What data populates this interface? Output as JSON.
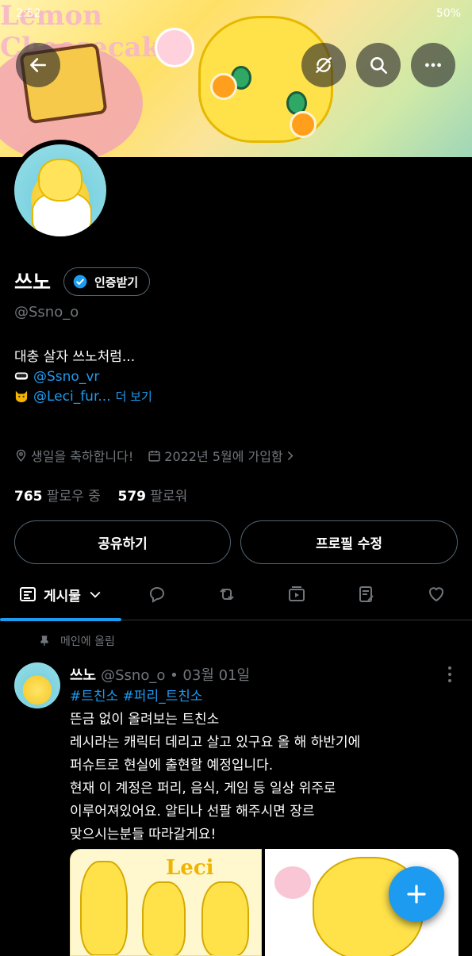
{
  "status_bar": {
    "time": "2:52",
    "indicators": "50% "
  },
  "banner": {
    "art_text": "Lemon Cheesecake"
  },
  "profile": {
    "display_name": "쓰노",
    "verify_label": "인증받기",
    "handle": "@Ssno_o",
    "bio_line1": "대충 살자 쓰노처럼...",
    "bio_link1": "@Ssno_vr",
    "bio_link2": "@Leci_fur...",
    "bio_more": "더 보기",
    "birthday": "생일을 축하합니다!",
    "joined": "2022년 5월에 가입함",
    "following_count": "765",
    "following_label": "팔로우 중",
    "followers_count": "579",
    "followers_label": "팔로워"
  },
  "actions": {
    "share": "공유하기",
    "edit_profile": "프로필 수정"
  },
  "tabs": {
    "posts": "게시물"
  },
  "pinned_label": "메인에 올림",
  "post": {
    "name": "쓰노",
    "handle_date": "@Ssno_o • 03월 01일",
    "tags": "#트친소 #퍼리_트친소",
    "lines": [
      "뜬금 없이 올려보는 트친소",
      "레시라는 캐릭터 데리고 살고 있구요 올 해 하반기에",
      "퍼슈트로 현실에 출현할 예정입니다.",
      "현재 이 계정은 퍼리, 음식, 게임 등 일상 위주로",
      "이루어져있어요. 알티나 선팔 해주시면 장르",
      "맞으시는분들 따라갈게요!"
    ],
    "media_text": "Leci"
  },
  "icons": [
    "back-arrow-icon",
    "no-sync-icon",
    "search-icon",
    "more-icon",
    "verified-badge-icon",
    "location-icon",
    "calendar-icon",
    "chevron-right-icon",
    "posts-tab-icon",
    "chevron-down-icon",
    "reply-icon",
    "retweet-icon",
    "media-icon",
    "article-icon",
    "like-icon",
    "pin-icon",
    "compose-plus-icon"
  ],
  "colors": {
    "accent": "#1d9bf0",
    "muted": "#71767b",
    "border": "#536471"
  }
}
